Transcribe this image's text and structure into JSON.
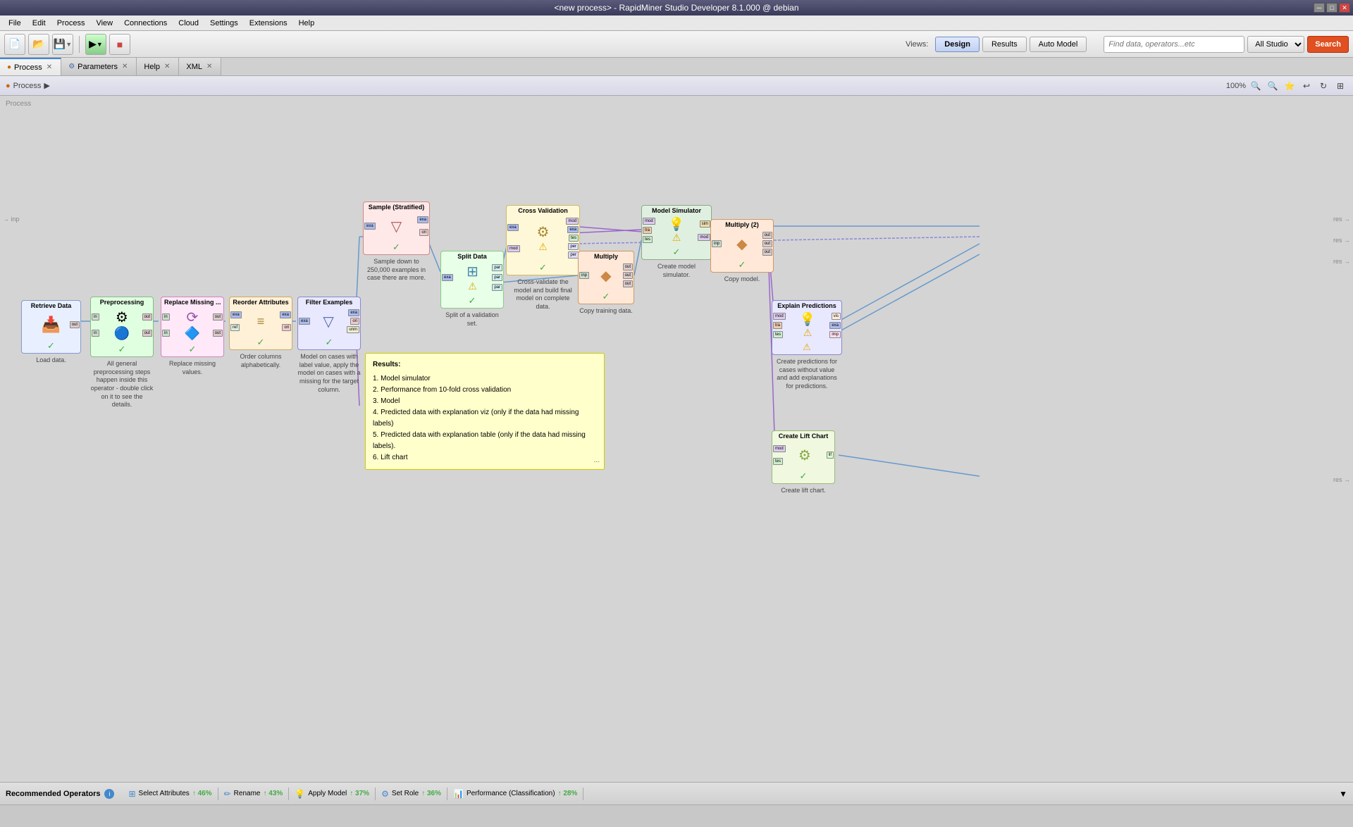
{
  "titleBar": {
    "title": "<new process> - RapidMiner Studio Developer 8.1.000 @ debian"
  },
  "windowControls": {
    "minimize": "─",
    "restore": "□",
    "close": "✕"
  },
  "menuBar": {
    "items": [
      "File",
      "Edit",
      "Process",
      "View",
      "Connections",
      "Cloud",
      "Settings",
      "Extensions",
      "Help"
    ]
  },
  "toolbar": {
    "newLabel": "📄",
    "openLabel": "📂",
    "saveLabel": "💾",
    "saveDropLabel": "▼",
    "runLabel": "▶",
    "runDropLabel": "▼",
    "stopLabel": "■",
    "viewsLabel": "Views:",
    "designBtn": "Design",
    "resultsBtn": "Results",
    "autoModelBtn": "Auto Model",
    "searchPlaceholder": "Find data, operators...etc",
    "searchScope": "All Studio",
    "searchBtn": "Search"
  },
  "tabs": [
    {
      "id": "process",
      "label": "Process",
      "icon": "●",
      "closable": true
    },
    {
      "id": "parameters",
      "label": "Parameters",
      "icon": "⚙",
      "closable": true
    },
    {
      "id": "help",
      "label": "Help",
      "closable": true
    },
    {
      "id": "xml",
      "label": "XML",
      "closable": true
    }
  ],
  "processHeader": {
    "breadcrumb": "Process",
    "arrowLabel": "▶",
    "zoomLevel": "100%",
    "tools": [
      "🔍",
      "🔍",
      "⭐",
      "↩",
      "↻",
      "⊞"
    ]
  },
  "canvasLabel": "Process",
  "inputLabel": "inp",
  "nodes": [
    {
      "id": "retrieve",
      "title": "Retrieve Data",
      "desc": "Load data.",
      "color": "node-retrieve",
      "icon": "↓",
      "ports_left": [],
      "ports_right": [
        "out"
      ],
      "status": "ok"
    },
    {
      "id": "preprocess",
      "title": "Preprocessing",
      "desc": "All general preprocessing steps happen inside this operator - double click on it to see the details.",
      "color": "node-preprocess",
      "icon": "⚙",
      "ports_left": [
        "in",
        "in"
      ],
      "ports_right": [
        "out",
        "out"
      ],
      "status": "ok"
    },
    {
      "id": "replace",
      "title": "Replace Missing ...",
      "desc": "Replace missing values.",
      "color": "node-replace",
      "icon": "⟳",
      "ports_left": [
        "in",
        "in"
      ],
      "ports_right": [
        "out",
        "out"
      ],
      "status": "ok"
    },
    {
      "id": "reorder",
      "title": "Reorder Attributes",
      "desc": "Order columns alphabetically.",
      "color": "node-reorder",
      "icon": "≡",
      "ports_left": [
        "exa",
        "ref"
      ],
      "ports_right": [
        "exa",
        "ori"
      ],
      "status": "ok"
    },
    {
      "id": "filter",
      "title": "Filter Examples",
      "desc": "Model on cases with label value, apply the model on cases with a missing for the target column.",
      "color": "node-filter",
      "icon": "▽",
      "ports_left": [
        "exa"
      ],
      "ports_right": [
        "exa",
        "ori",
        "unm"
      ],
      "status": "ok"
    },
    {
      "id": "sample",
      "title": "Sample (Stratified)",
      "desc": "Sample down to 250,000 examples in case there are more.",
      "color": "node-sample",
      "icon": "▽",
      "ports_left": [
        "exa"
      ],
      "ports_right": [
        "exa",
        "ori"
      ],
      "status": "ok"
    },
    {
      "id": "split",
      "title": "Split Data",
      "desc": "Split of a validation set.",
      "color": "node-split",
      "icon": "⊞",
      "ports_left": [
        "exa"
      ],
      "ports_right": [
        "par",
        "par",
        "par"
      ],
      "status": "ok"
    },
    {
      "id": "crossval",
      "title": "Cross Validation",
      "desc": "Cross-validate the model and build final model on complete data.",
      "color": "node-crossval",
      "icon": "⚙",
      "ports_left": [
        "exa",
        "mod"
      ],
      "ports_right": [
        "mod",
        "exa",
        "tes",
        "per",
        "per"
      ],
      "status": "warn"
    },
    {
      "id": "multiply",
      "title": "Multiply",
      "desc": "Copy training data.",
      "color": "node-multiply",
      "icon": "◆",
      "ports_left": [
        "inp"
      ],
      "ports_right": [
        "out",
        "out",
        "out"
      ],
      "status": "ok"
    },
    {
      "id": "model-sim",
      "title": "Model Simulator",
      "desc": "Create model simulator.",
      "color": "node-model-sim",
      "icon": "💡",
      "ports_left": [
        "mod",
        "tra",
        "tes"
      ],
      "ports_right": [
        "sim",
        "mod"
      ],
      "status": "warn"
    },
    {
      "id": "multiply2",
      "title": "Multiply (2)",
      "desc": "Copy model.",
      "color": "node-multiply2",
      "icon": "◆",
      "ports_left": [
        "inp"
      ],
      "ports_right": [
        "out",
        "out",
        "out"
      ],
      "status": "ok"
    },
    {
      "id": "explain",
      "title": "Explain Predictions",
      "desc": "Create predictions for cases without value and add explanations for predictions.",
      "color": "node-explain",
      "icon": "💡",
      "ports_left": [
        "mod",
        "tra",
        "tes"
      ],
      "ports_right": [
        "vis",
        "exa",
        "imp"
      ],
      "status": "warn"
    },
    {
      "id": "lift",
      "title": "Create Lift Chart",
      "desc": "Create lift chart.",
      "color": "node-lift",
      "icon": "⚙",
      "ports_left": [
        "mod",
        "tes"
      ],
      "ports_right": [
        "lif"
      ],
      "status": "ok"
    }
  ],
  "tooltip": {
    "title": "Results:",
    "items": [
      "1. Model simulator",
      "2. Performance from 10-fold cross validation",
      "3. Model",
      "4. Predicted data with explanation viz (only if the data had missing labels)",
      "5. Predicted data with explanation table (only if the data had missing labels).",
      "6. Lift chart"
    ],
    "moreBtn": "..."
  },
  "recommendedOps": {
    "sectionTitle": "Recommended Operators",
    "ops": [
      {
        "icon": "⊞",
        "label": "Select Attributes",
        "pct": "46%",
        "color": "#4488cc"
      },
      {
        "icon": "✏",
        "label": "Rename",
        "pct": "43%",
        "color": "#4488cc"
      },
      {
        "icon": "💡",
        "label": "Apply Model",
        "pct": "37%",
        "color": "#ddaa00"
      },
      {
        "icon": "⚙",
        "label": "Set Role",
        "pct": "36%",
        "color": "#4488cc"
      },
      {
        "icon": "📊",
        "label": "Performance (Classification)",
        "pct": "28%",
        "color": "#aa44aa"
      }
    ]
  }
}
